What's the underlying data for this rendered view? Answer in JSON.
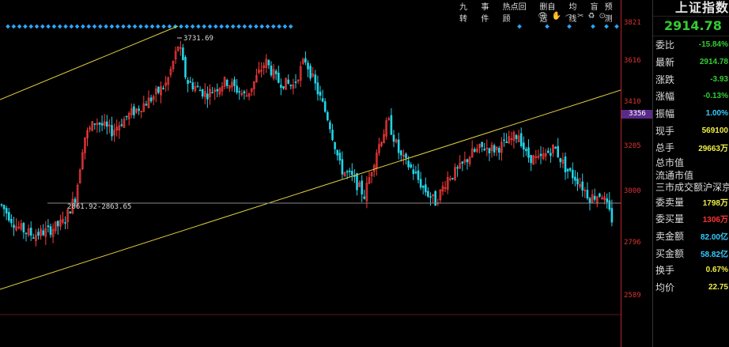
{
  "toolbar": {
    "items": [
      "九转",
      "事件",
      "热点回顾",
      "删自选",
      "均线",
      "盲",
      "预测"
    ]
  },
  "tool_icons": [
    "👁",
    "✋",
    "⌒",
    "✂",
    "♻",
    "⊙"
  ],
  "axis": {
    "labels": [
      "3821",
      "3616",
      "3410",
      "3205",
      "3000",
      "2796",
      "2589"
    ],
    "current": "3356"
  },
  "chart": {
    "high_annotation": "3731.69",
    "low_annotation": "2861.92-2863.65",
    "colors": {
      "up": "#ff3b3b",
      "down": "#22d4e8",
      "trendline": "#e0d040",
      "hline": "#888888",
      "marker": "#29a6ff"
    }
  },
  "chart_data": {
    "type": "candlestick",
    "ylim": [
      2589,
      3821
    ],
    "y_ticks": [
      3821,
      3616,
      3410,
      3205,
      3000,
      2796,
      2589
    ],
    "annotations": [
      "3731.69",
      "2861.92-2863.65"
    ]
  },
  "panel": {
    "title": "上证指数",
    "price": "2914.78",
    "rows": [
      {
        "label": "委比",
        "value": "-15.84%",
        "cls": "g"
      },
      {
        "label": "最新",
        "value": "2914.78",
        "cls": "g"
      },
      {
        "label": "涨跌",
        "value": "-3.93",
        "cls": "g"
      },
      {
        "label": "涨幅",
        "value": "-0.13%",
        "cls": "g"
      },
      {
        "label": "振幅",
        "value": "1.00%",
        "cls": "c"
      },
      {
        "label": "现手",
        "value": "569100",
        "cls": "y"
      },
      {
        "label": "总手",
        "value": "29663万",
        "cls": "y"
      }
    ],
    "text_rows": [
      "总市值",
      "流通市值",
      "三市成交额沪深京"
    ],
    "rows2": [
      {
        "label": "委卖量",
        "value": "1798万",
        "cls": "y"
      },
      {
        "label": "委买量",
        "value": "1306万",
        "cls": "r"
      },
      {
        "label": "卖金额",
        "value": "82.00亿",
        "cls": "c"
      },
      {
        "label": "买金额",
        "value": "58.82亿",
        "cls": "c"
      },
      {
        "label": "换手",
        "value": "0.67%",
        "cls": "y"
      },
      {
        "label": "均价",
        "value": "22.75",
        "cls": "y"
      }
    ]
  }
}
